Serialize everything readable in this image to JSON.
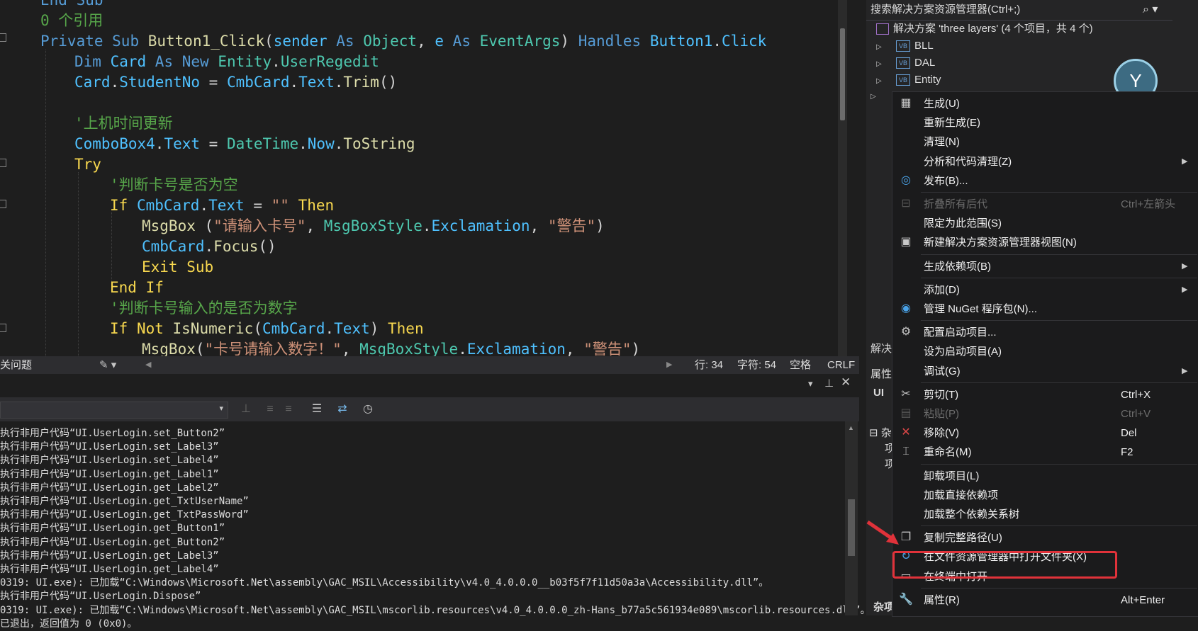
{
  "editor": {
    "lines": [
      [
        [
          "kw",
          "End Sub"
        ]
      ],
      [
        [
          "cm",
          "0 个引用"
        ]
      ],
      [
        [
          "kw",
          "Private "
        ],
        [
          "kw",
          "Sub "
        ],
        [
          "mt",
          "Button1_Click"
        ],
        [
          "pl",
          "("
        ],
        [
          "id",
          "sender "
        ],
        [
          "kw",
          "As "
        ],
        [
          "ty",
          "Object"
        ],
        [
          "pl",
          ", "
        ],
        [
          "id",
          "e "
        ],
        [
          "kw",
          "As "
        ],
        [
          "ty",
          "EventArgs"
        ],
        [
          "pl",
          ") "
        ],
        [
          "kw",
          "Handles "
        ],
        [
          "id",
          "Button1"
        ],
        [
          "pl",
          "."
        ],
        [
          "id",
          "Click"
        ]
      ],
      [
        [
          "kw",
          "Dim "
        ],
        [
          "id",
          "Card "
        ],
        [
          "kw",
          "As "
        ],
        [
          "kw",
          "New "
        ],
        [
          "ty",
          "Entity"
        ],
        [
          "pl",
          "."
        ],
        [
          "ty",
          "UserRegedit"
        ]
      ],
      [
        [
          "id",
          "Card"
        ],
        [
          "pl",
          "."
        ],
        [
          "id",
          "StudentNo "
        ],
        [
          "pl",
          "= "
        ],
        [
          "id",
          "CmbCard"
        ],
        [
          "pl",
          "."
        ],
        [
          "id",
          "Text"
        ],
        [
          "pl",
          "."
        ],
        [
          "mt",
          "Trim"
        ],
        [
          "pl",
          "()"
        ]
      ],
      [
        [
          "pl",
          ""
        ]
      ],
      [
        [
          "cm",
          "'上机时间更新"
        ]
      ],
      [
        [
          "id",
          "ComboBox4"
        ],
        [
          "pl",
          "."
        ],
        [
          "id",
          "Text "
        ],
        [
          "pl",
          "= "
        ],
        [
          "ty",
          "DateTime"
        ],
        [
          "pl",
          "."
        ],
        [
          "id",
          "Now"
        ],
        [
          "pl",
          "."
        ],
        [
          "mt",
          "ToString"
        ]
      ],
      [
        [
          "ylw",
          "Try"
        ]
      ],
      [
        [
          "cm",
          "'判断卡号是否为空"
        ]
      ],
      [
        [
          "ylw",
          "If "
        ],
        [
          "id",
          "CmbCard"
        ],
        [
          "pl",
          "."
        ],
        [
          "id",
          "Text "
        ],
        [
          "pl",
          "= "
        ],
        [
          "st",
          "\"\" "
        ],
        [
          "ylw",
          "Then"
        ]
      ],
      [
        [
          "mt",
          "MsgBox "
        ],
        [
          "pl",
          "("
        ],
        [
          "st",
          "\"请输入卡号\""
        ],
        [
          "pl",
          ", "
        ],
        [
          "ty",
          "MsgBoxStyle"
        ],
        [
          "pl",
          "."
        ],
        [
          "id",
          "Exclamation"
        ],
        [
          "pl",
          ", "
        ],
        [
          "st",
          "\"警告\""
        ],
        [
          "pl",
          ")"
        ]
      ],
      [
        [
          "id",
          "CmbCard"
        ],
        [
          "pl",
          "."
        ],
        [
          "mt",
          "Focus"
        ],
        [
          "pl",
          "()"
        ]
      ],
      [
        [
          "ylw",
          "Exit "
        ],
        [
          "ylw",
          "Sub"
        ]
      ],
      [
        [
          "ylw",
          "End "
        ],
        [
          "ylw",
          "If"
        ]
      ],
      [
        [
          "cm",
          "'判断卡号输入的是否为数字"
        ]
      ],
      [
        [
          "ylw",
          "If "
        ],
        [
          "ylw",
          "Not "
        ],
        [
          "mt",
          "IsNumeric"
        ],
        [
          "pl",
          "("
        ],
        [
          "id",
          "CmbCard"
        ],
        [
          "pl",
          "."
        ],
        [
          "id",
          "Text"
        ],
        [
          "pl",
          ") "
        ],
        [
          "ylw",
          "Then"
        ]
      ],
      [
        [
          "mt",
          "MsgBox"
        ],
        [
          "pl",
          "("
        ],
        [
          "st",
          "\"卡号请输入数字！\""
        ],
        [
          "pl",
          ", "
        ],
        [
          "ty",
          "MsgBoxStyle"
        ],
        [
          "pl",
          "."
        ],
        [
          "id",
          "Exclamation"
        ],
        [
          "pl",
          ", "
        ],
        [
          "st",
          "\"警告\""
        ],
        [
          "pl",
          ")"
        ]
      ]
    ]
  },
  "statusbar": {
    "issues": "关问题",
    "line": "行: 34",
    "char": "字符: 54",
    "spaces": "空格",
    "eol": "CRLF"
  },
  "output": {
    "lines": [
      "执行非用户代码“UI.UserLogin.set_Button2”",
      "执行非用户代码“UI.UserLogin.set_Label3”",
      "执行非用户代码“UI.UserLogin.set_Label4”",
      "执行非用户代码“UI.UserLogin.get_Label1”",
      "执行非用户代码“UI.UserLogin.get_Label2”",
      "执行非用户代码“UI.UserLogin.get_TxtUserName”",
      "执行非用户代码“UI.UserLogin.get_TxtPassWord”",
      "执行非用户代码“UI.UserLogin.get_Button1”",
      "执行非用户代码“UI.UserLogin.get_Button2”",
      "执行非用户代码“UI.UserLogin.get_Label3”",
      "执行非用户代码“UI.UserLogin.get_Label4”",
      "0319: UI.exe): 已加载“C:\\Windows\\Microsoft.Net\\assembly\\GAC_MSIL\\Accessibility\\v4.0_4.0.0.0__b03f5f7f11d50a3a\\Accessibility.dll”。",
      "执行非用户代码“UI.UserLogin.Dispose”",
      "0319: UI.exe): 已加载“C:\\Windows\\Microsoft.Net\\assembly\\GAC_MSIL\\mscorlib.resources\\v4.0_4.0.0.0_zh-Hans_b77a5c561934e089\\mscorlib.resources.dll”。",
      "已退出，返回值为 0 (0x0)。"
    ]
  },
  "solution": {
    "search_placeholder": "搜索解决方案资源管理器(Ctrl+;)",
    "root": "解决方案 'three layers' (4 个项目，共 4 个)",
    "projects": [
      "BLL",
      "DAL",
      "Entity"
    ],
    "side_labels": {
      "solution_tab": "解决",
      "properties": "属性",
      "ui": "UI ",
      "misc": "杂",
      "item1": "项",
      "item2": "项",
      "misc2": "杂项"
    }
  },
  "context_menu": {
    "items": [
      {
        "icon": "build-icon",
        "glyph": "▦",
        "label": "生成(U)",
        "shortcut": "",
        "arrow": false,
        "disabled": false
      },
      {
        "icon": "",
        "glyph": "",
        "label": "重新生成(E)",
        "shortcut": "",
        "arrow": false,
        "disabled": false
      },
      {
        "icon": "",
        "glyph": "",
        "label": "清理(N)",
        "shortcut": "",
        "arrow": false,
        "disabled": false
      },
      {
        "icon": "",
        "glyph": "",
        "label": "分析和代码清理(Z)",
        "shortcut": "",
        "arrow": true,
        "disabled": false
      },
      {
        "icon": "globe-icon",
        "glyph": "◎",
        "label": "发布(B)...",
        "shortcut": "",
        "arrow": false,
        "disabled": false
      },
      {
        "sep": true
      },
      {
        "icon": "collapse-icon",
        "glyph": "⊟",
        "label": "折叠所有后代",
        "shortcut": "Ctrl+左箭头",
        "arrow": false,
        "disabled": true
      },
      {
        "icon": "",
        "glyph": "",
        "label": "限定为此范围(S)",
        "shortcut": "",
        "arrow": false,
        "disabled": false
      },
      {
        "icon": "new-view-icon",
        "glyph": "▣",
        "label": "新建解决方案资源管理器视图(N)",
        "shortcut": "",
        "arrow": false,
        "disabled": false
      },
      {
        "sep": true
      },
      {
        "icon": "",
        "glyph": "",
        "label": "生成依赖项(B)",
        "shortcut": "",
        "arrow": true,
        "disabled": false
      },
      {
        "sep": true
      },
      {
        "icon": "",
        "glyph": "",
        "label": "添加(D)",
        "shortcut": "",
        "arrow": true,
        "disabled": false
      },
      {
        "icon": "nuget-icon",
        "glyph": "◉",
        "label": "管理 NuGet 程序包(N)...",
        "shortcut": "",
        "arrow": false,
        "disabled": false
      },
      {
        "sep": true
      },
      {
        "icon": "gear-icon",
        "glyph": "⚙",
        "label": "配置启动项目...",
        "shortcut": "",
        "arrow": false,
        "disabled": false
      },
      {
        "icon": "",
        "glyph": "",
        "label": "设为启动项目(A)",
        "shortcut": "",
        "arrow": false,
        "disabled": false
      },
      {
        "icon": "",
        "glyph": "",
        "label": "调试(G)",
        "shortcut": "",
        "arrow": true,
        "disabled": false
      },
      {
        "sep": true
      },
      {
        "icon": "scissors-icon",
        "glyph": "✂",
        "label": "剪切(T)",
        "shortcut": "Ctrl+X",
        "arrow": false,
        "disabled": false
      },
      {
        "icon": "paste-icon",
        "glyph": "▤",
        "label": "粘贴(P)",
        "shortcut": "Ctrl+V",
        "arrow": false,
        "disabled": true
      },
      {
        "icon": "remove-icon",
        "glyph": "✕",
        "label": "移除(V)",
        "shortcut": "Del",
        "arrow": false,
        "disabled": false
      },
      {
        "icon": "rename-icon",
        "glyph": "⌶",
        "label": "重命名(M)",
        "shortcut": "F2",
        "arrow": false,
        "disabled": false
      },
      {
        "sep": true
      },
      {
        "icon": "",
        "glyph": "",
        "label": "卸载项目(L)",
        "shortcut": "",
        "arrow": false,
        "disabled": false
      },
      {
        "icon": "",
        "glyph": "",
        "label": "加载直接依赖项",
        "shortcut": "",
        "arrow": false,
        "disabled": false
      },
      {
        "icon": "",
        "glyph": "",
        "label": "加载整个依赖关系树",
        "shortcut": "",
        "arrow": false,
        "disabled": false
      },
      {
        "sep": true
      },
      {
        "icon": "copy-icon",
        "glyph": "❐",
        "label": "复制完整路径(U)",
        "shortcut": "",
        "arrow": false,
        "disabled": false
      },
      {
        "icon": "open-folder-icon",
        "glyph": "↻",
        "label": "在文件资源管理器中打开文件夹(X)",
        "shortcut": "",
        "arrow": false,
        "disabled": false
      },
      {
        "icon": "terminal-icon",
        "glyph": "▭",
        "label": "在终端中打开",
        "shortcut": "",
        "arrow": false,
        "disabled": false
      },
      {
        "sep": true
      },
      {
        "icon": "wrench-icon",
        "glyph": "🔧",
        "label": "属性(R)",
        "shortcut": "Alt+Enter",
        "arrow": false,
        "disabled": false
      }
    ]
  },
  "colors": {
    "highlight_border": "#e0323a",
    "menu_bg": "#1b1b1c"
  }
}
